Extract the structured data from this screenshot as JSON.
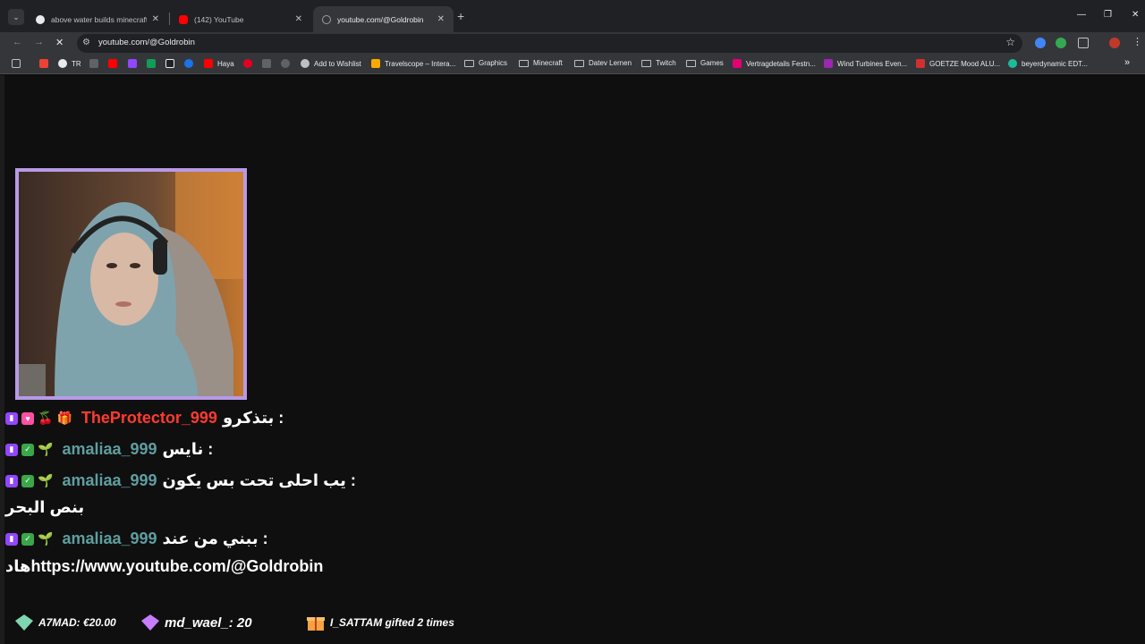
{
  "tabs": [
    {
      "title": "above water builds minecraft",
      "active": false
    },
    {
      "title": "(142) YouTube",
      "active": false
    },
    {
      "title": "youtube.com/@Goldrobin",
      "active": true
    }
  ],
  "toolbar": {
    "url": "youtube.com/@Goldrobin"
  },
  "bookmarks": [
    {
      "label": "TR"
    },
    {
      "label": "Haya"
    },
    {
      "label": "Add to Wishlist"
    },
    {
      "label": "Travelscope – Intera..."
    },
    {
      "label": "Graphics"
    },
    {
      "label": "Minecraft"
    },
    {
      "label": "Datev Lernen"
    },
    {
      "label": "Twitch"
    },
    {
      "label": "Games"
    },
    {
      "label": "Vertragdetails Festn..."
    },
    {
      "label": "Wind Turbines Even..."
    },
    {
      "label": "GOETZE Mood ALU..."
    },
    {
      "label": "beyerdynamic EDT..."
    }
  ],
  "chat": [
    {
      "user": "TheProtector_999",
      "user_color": "#ff3b30",
      "message": "بتذكرو :"
    },
    {
      "user": "amaliaa_999",
      "user_color": "#5f9ea0",
      "message": "نايس :"
    },
    {
      "user": "amaliaa_999",
      "user_color": "#5f9ea0",
      "message": "يب احلى تحت بس يكون :",
      "continuation": "بنص البحر"
    },
    {
      "user": "amaliaa_999",
      "user_color": "#5f9ea0",
      "message": "ببني من عند :",
      "continuation": "هادhttps://www.youtube.com/@Goldrobin"
    }
  ],
  "ticker": [
    {
      "text": "A7MAD: €20.00"
    },
    {
      "text": "md_wael_: 20"
    },
    {
      "text": "I_SATTAM gifted 2 times"
    }
  ],
  "colors": {
    "accent_purple": "#9146ff",
    "cam_border": "#b79ae6"
  }
}
